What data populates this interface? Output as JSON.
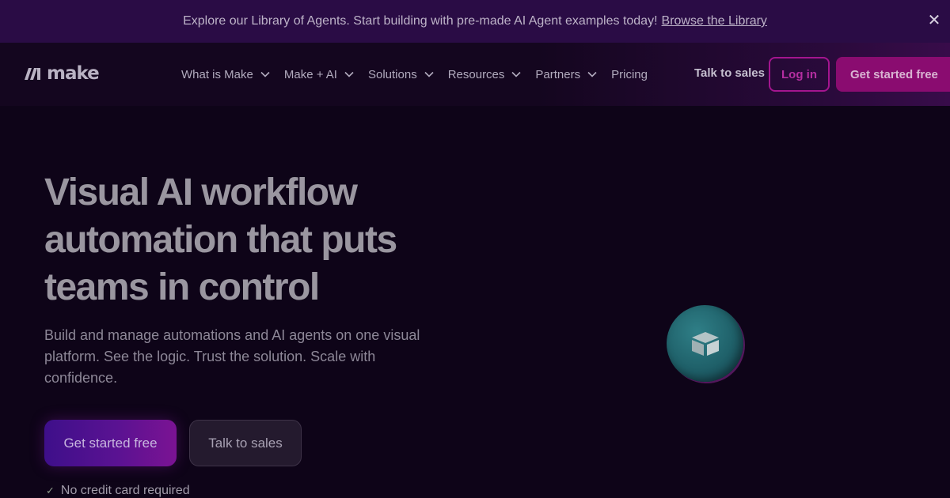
{
  "banner": {
    "text": "Explore our Library of Agents. Start building with pre-made AI Agent examples today!",
    "link": "Browse the Library",
    "close_icon": "close-icon"
  },
  "nav": {
    "logo_text": "make",
    "logo_icon": "make-logo-icon",
    "menu": [
      {
        "label": "What is Make",
        "has_dropdown": true
      },
      {
        "label": "Make + AI",
        "has_dropdown": true
      },
      {
        "label": "Solutions",
        "has_dropdown": true
      },
      {
        "label": "Resources",
        "has_dropdown": true
      },
      {
        "label": "Partners",
        "has_dropdown": true
      },
      {
        "label": "Pricing",
        "has_dropdown": false
      }
    ],
    "talk_to_sales": "Talk to sales",
    "login": "Log in",
    "get_started": "Get started free"
  },
  "hero": {
    "title": "Visual AI workflow automation that puts teams in control",
    "subtitle": "Build and manage automations and AI agents on one visual platform. See the logic. Trust the solution. Scale with confidence.",
    "cta_primary": "Get started free",
    "cta_secondary": "Talk to sales",
    "note": "No credit card required",
    "orb_icon": "box-icon"
  },
  "colors": {
    "background": "#0e0418",
    "banner": "#2a0c45",
    "accent": "#8a0c70",
    "login_border": "#a4158f"
  }
}
